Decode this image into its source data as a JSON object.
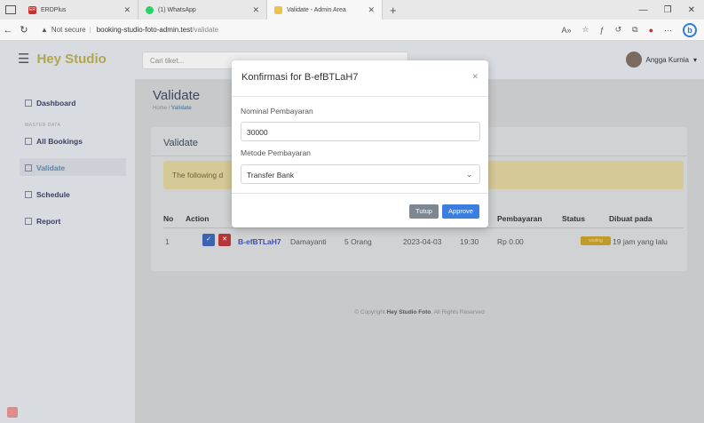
{
  "browser": {
    "tabs": [
      {
        "label": "ERDPlus",
        "badge": "ER",
        "favicon_color": "#c9302c"
      },
      {
        "label": "(1) WhatsApp",
        "favicon_color": "#25d366"
      },
      {
        "label": "Validate - Admin Area",
        "favicon_color": "#f0c14b"
      }
    ],
    "not_secure": "Not secure",
    "url_host": "booking-studio-foto-admin.test",
    "url_path": "/validate"
  },
  "header": {
    "brand": "Hey Studio",
    "search_placeholder": "Cari tiket...",
    "user_name": "Angga Kurnia"
  },
  "sidebar": {
    "section_label": "MASTER DATA",
    "items": [
      {
        "label": "Dashboard"
      },
      {
        "label": "All Bookings"
      },
      {
        "label": "Validate"
      },
      {
        "label": "Schedule"
      },
      {
        "label": "Report"
      }
    ]
  },
  "main": {
    "title": "Validate",
    "breadcrumb_home": "Home",
    "breadcrumb_sep": "/",
    "breadcrumb_current": "Validate",
    "card_title": "Validate",
    "alert_text": "The following d",
    "table": {
      "headers": [
        "No",
        "Action",
        "Pembayaran",
        "Status",
        "Dibuat pada"
      ],
      "row": {
        "no": "1",
        "code": "B-efBTLaH7",
        "name": "Damayanti",
        "people": "5 Orang",
        "date": "2023-04-03",
        "time": "19:30",
        "payment": "Rp 0.00",
        "status": "waiting",
        "created": "19 jam yang lalu"
      }
    },
    "footer_prefix": "© Copyright",
    "footer_brand": "Hey Studio Foto",
    "footer_suffix": ". All Rights Reserved"
  },
  "modal": {
    "title": "Konfirmasi for B-efBTLaH7",
    "nominal_label": "Nominal Pembayaran",
    "nominal_value": "30000",
    "method_label": "Metode Pembayaran",
    "method_value": "Transfer Bank",
    "close_label": "Tutup",
    "approve_label": "Approve"
  },
  "colors": {
    "brand": "#b1a64e",
    "approve": "#3c7de0",
    "tutup": "#7d8791",
    "btn_ok": "#3d62b0",
    "btn_del": "#b53636"
  }
}
